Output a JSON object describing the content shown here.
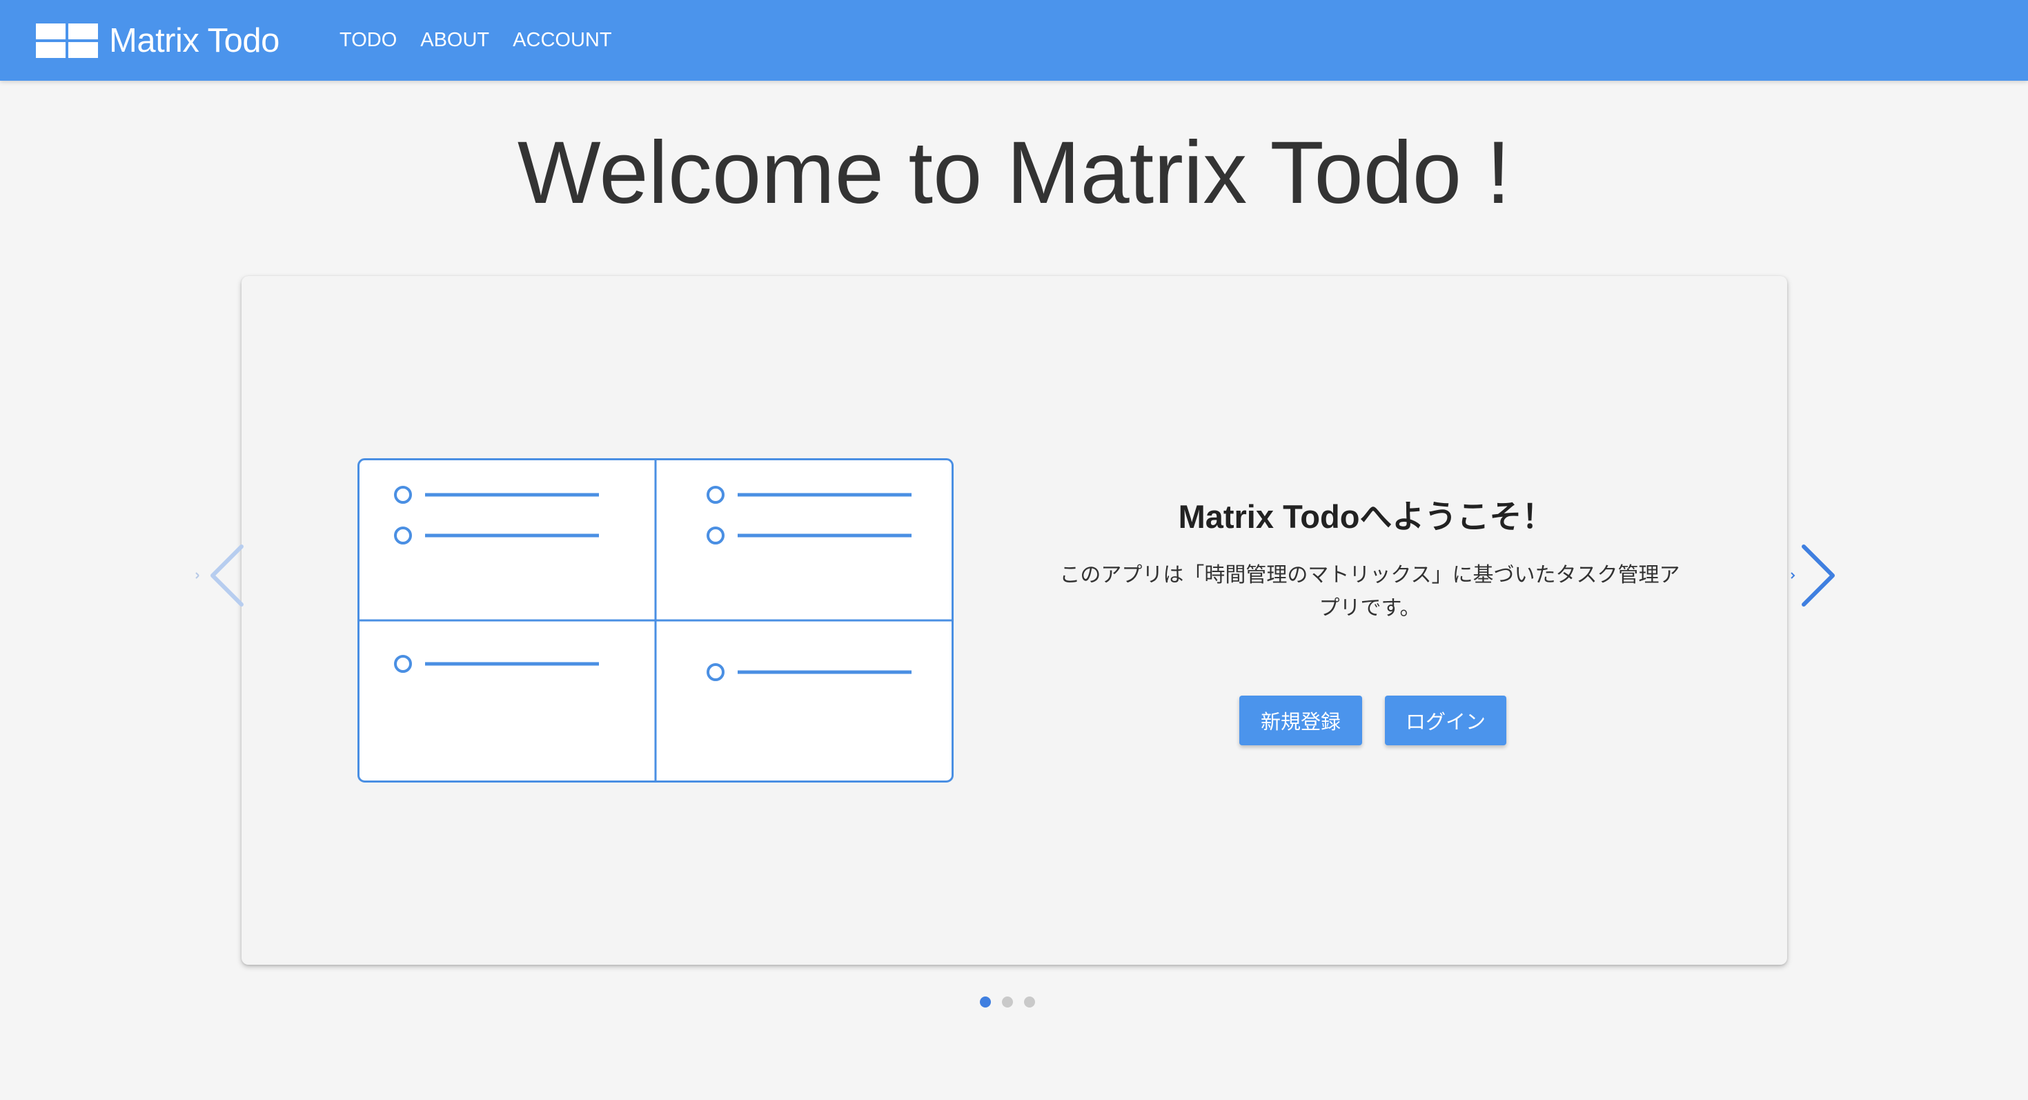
{
  "navbar": {
    "brand": "Matrix Todo",
    "links": [
      "TODO",
      "ABOUT",
      "ACCOUNT"
    ]
  },
  "page_title": "Welcome to Matrix Todo !",
  "carousel": {
    "slide": {
      "heading": "Matrix Todoへようこそ！",
      "description_line1": "このアプリは「時間管理のマトリックス」に基づいたタスク管理ア",
      "description_line2": "プリです。",
      "register_label": "新規登録",
      "login_label": "ログイン"
    },
    "slide_count": 3,
    "active_index": 0
  },
  "colors": {
    "brand_blue": "#4b94ec",
    "illustration_blue": "#4a8fe3",
    "active_dot": "#3f7fe0"
  }
}
